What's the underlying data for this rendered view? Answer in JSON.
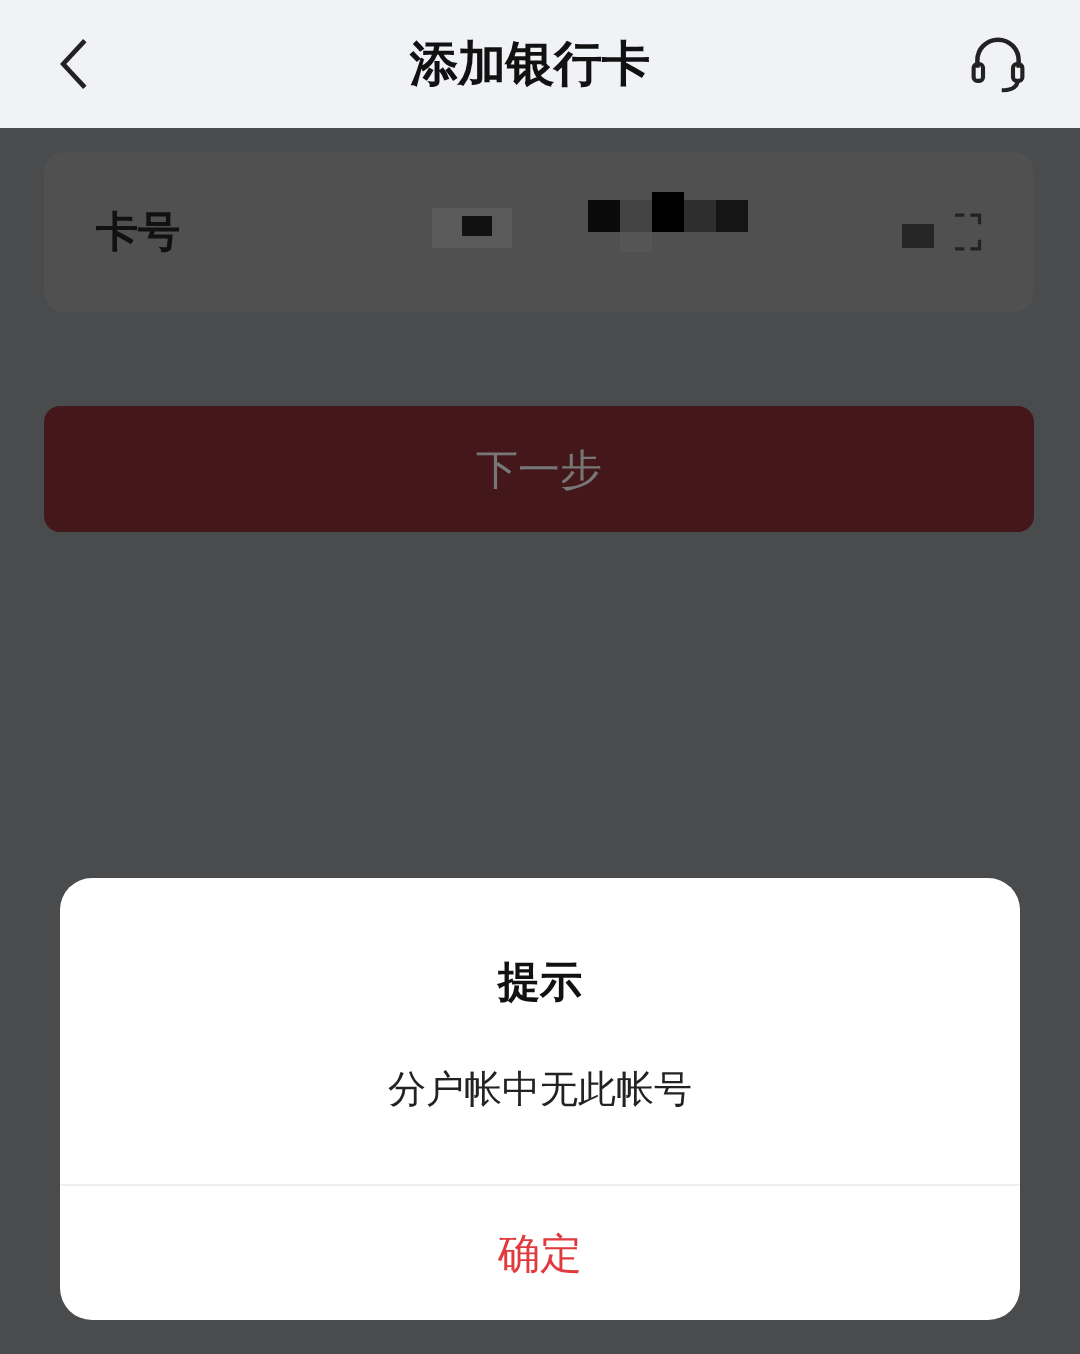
{
  "header": {
    "title": "添加银行卡"
  },
  "form": {
    "card_number_label": "卡号",
    "next_button": {
      "label": "下一步",
      "disabled": true
    }
  },
  "dialog": {
    "title": "提示",
    "message": "分户帐中无此帐号",
    "confirm": "确定"
  }
}
